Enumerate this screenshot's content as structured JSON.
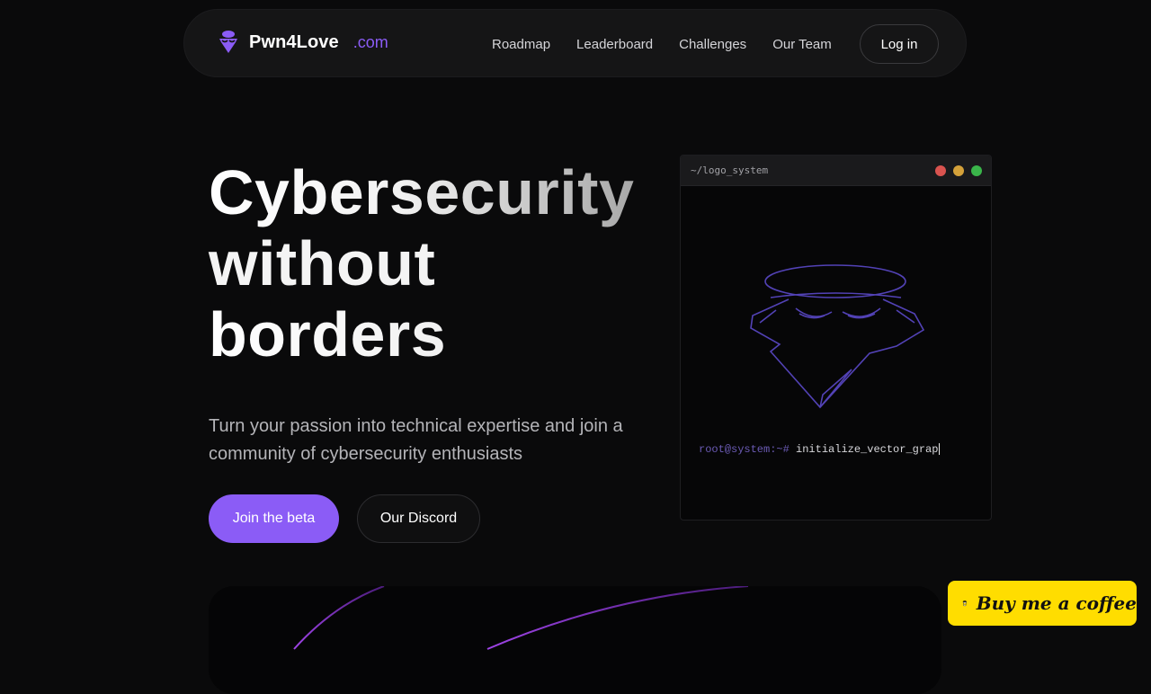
{
  "nav": {
    "brand_name": "Pwn4Love",
    "brand_tld": ".com",
    "links": [
      "Roadmap",
      "Leaderboard",
      "Challenges",
      "Our Team"
    ],
    "login_label": "Log in",
    "logo_icon": "hacker-icon"
  },
  "hero": {
    "title_line1": "Cybersecurity",
    "title_line2": "without",
    "title_line3": "borders",
    "subtitle": "Turn your passion into technical expertise and join a community of cybersecurity enthusiasts",
    "primary_button": "Join the beta",
    "secondary_button": "Our Discord"
  },
  "terminal": {
    "title": "~/logo_system",
    "prompt": "root@system:~#",
    "command": "initialize_vector_grap",
    "art_icon": "hacker-icon"
  },
  "coffee_button": {
    "label": "Buy me a coffee",
    "icon": "coffee-cup-icon"
  },
  "colors": {
    "accent": "#8b5cf6",
    "background": "#0a0a0b",
    "coffee_yellow": "#ffdd00"
  }
}
